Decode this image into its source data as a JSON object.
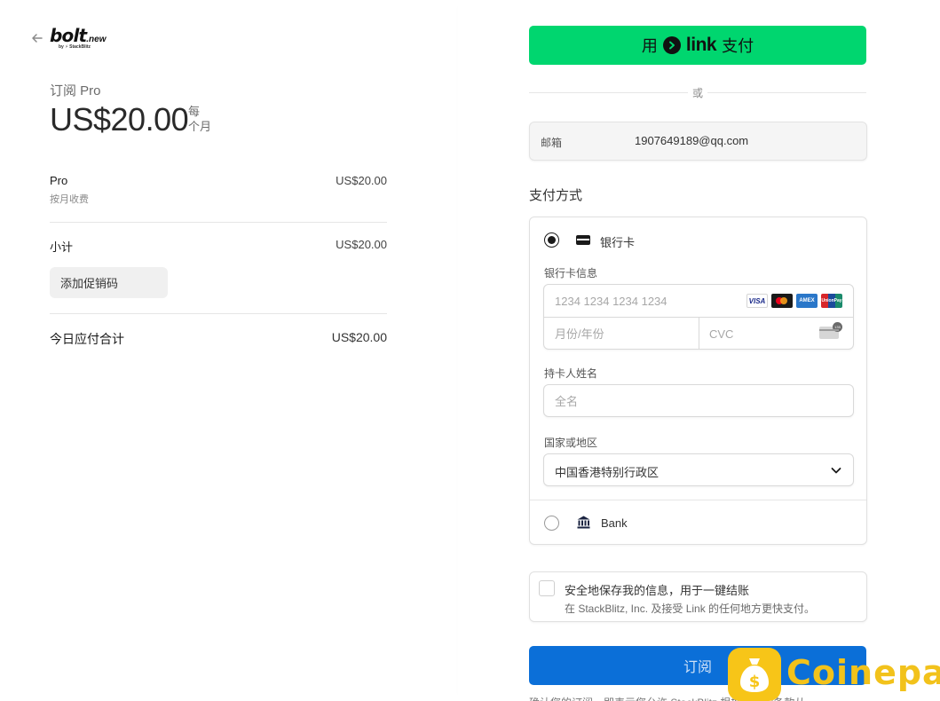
{
  "header": {
    "logo_main": "bolt",
    "logo_suffix": ".new",
    "logo_byline": "by ⚡ StackBlitz"
  },
  "summary": {
    "plan_label": "订阅 Pro",
    "price": "US$20.00",
    "period_line1": "每",
    "period_line2": "个月",
    "items": [
      {
        "name": "Pro",
        "sub": "按月收费",
        "amount": "US$20.00"
      }
    ],
    "subtotal_label": "小计",
    "subtotal_amount": "US$20.00",
    "promo_button": "添加促销码",
    "total_label": "今日应付合计",
    "total_amount": "US$20.00"
  },
  "checkout": {
    "link_pay_prefix": "用",
    "link_pay_brand": "link",
    "link_pay_suffix": "支付",
    "or_text": "或",
    "email_label": "邮箱",
    "email_value": "1907649189@qq.com",
    "payment_method_title": "支付方式",
    "card_option_label": "银行卡",
    "card_info_label": "银行卡信息",
    "card_number_placeholder": "1234 1234 1234 1234",
    "expiry_placeholder": "月份/年份",
    "cvc_placeholder": "CVC",
    "cvc_icon_text": "135",
    "brands": {
      "visa": "VISA",
      "amex": "AMEX",
      "unionpay": "UnionPay"
    },
    "holder_label": "持卡人姓名",
    "holder_placeholder": "全名",
    "country_label": "国家或地区",
    "country_value": "中国香港特别行政区",
    "bank_option_label": "Bank",
    "save_info_title": "安全地保存我的信息，用于一键结账",
    "save_info_sub": "在 StackBlitz, Inc. 及接受 Link 的任何地方更快支付。",
    "subscribe_button": "订阅",
    "footnote": "确认您的订阅，即表示您允许 StackBlitz 根据他们的条款从"
  },
  "watermark": {
    "text": "Coinepay"
  },
  "colors": {
    "link_green": "#00d66f",
    "subscribe_blue": "#0b6fd8",
    "watermark_yellow": "#f7c518"
  }
}
